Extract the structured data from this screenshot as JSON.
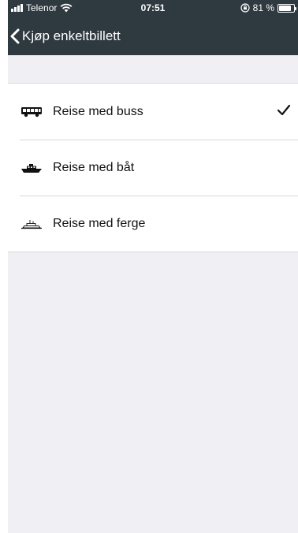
{
  "status_bar": {
    "carrier": "Telenor",
    "time": "07:51",
    "battery_percent_text": "81 %",
    "battery_level": 0.81
  },
  "nav": {
    "back_title": "Kjøp enkeltbillett"
  },
  "options": [
    {
      "label": "Reise med buss",
      "icon": "bus-icon",
      "selected": true
    },
    {
      "label": "Reise med båt",
      "icon": "boat-icon",
      "selected": false
    },
    {
      "label": "Reise med ferge",
      "icon": "ferry-icon",
      "selected": false
    }
  ],
  "colors": {
    "header_bg": "#2f3940",
    "background": "#efeff4",
    "list_bg": "#ffffff"
  }
}
